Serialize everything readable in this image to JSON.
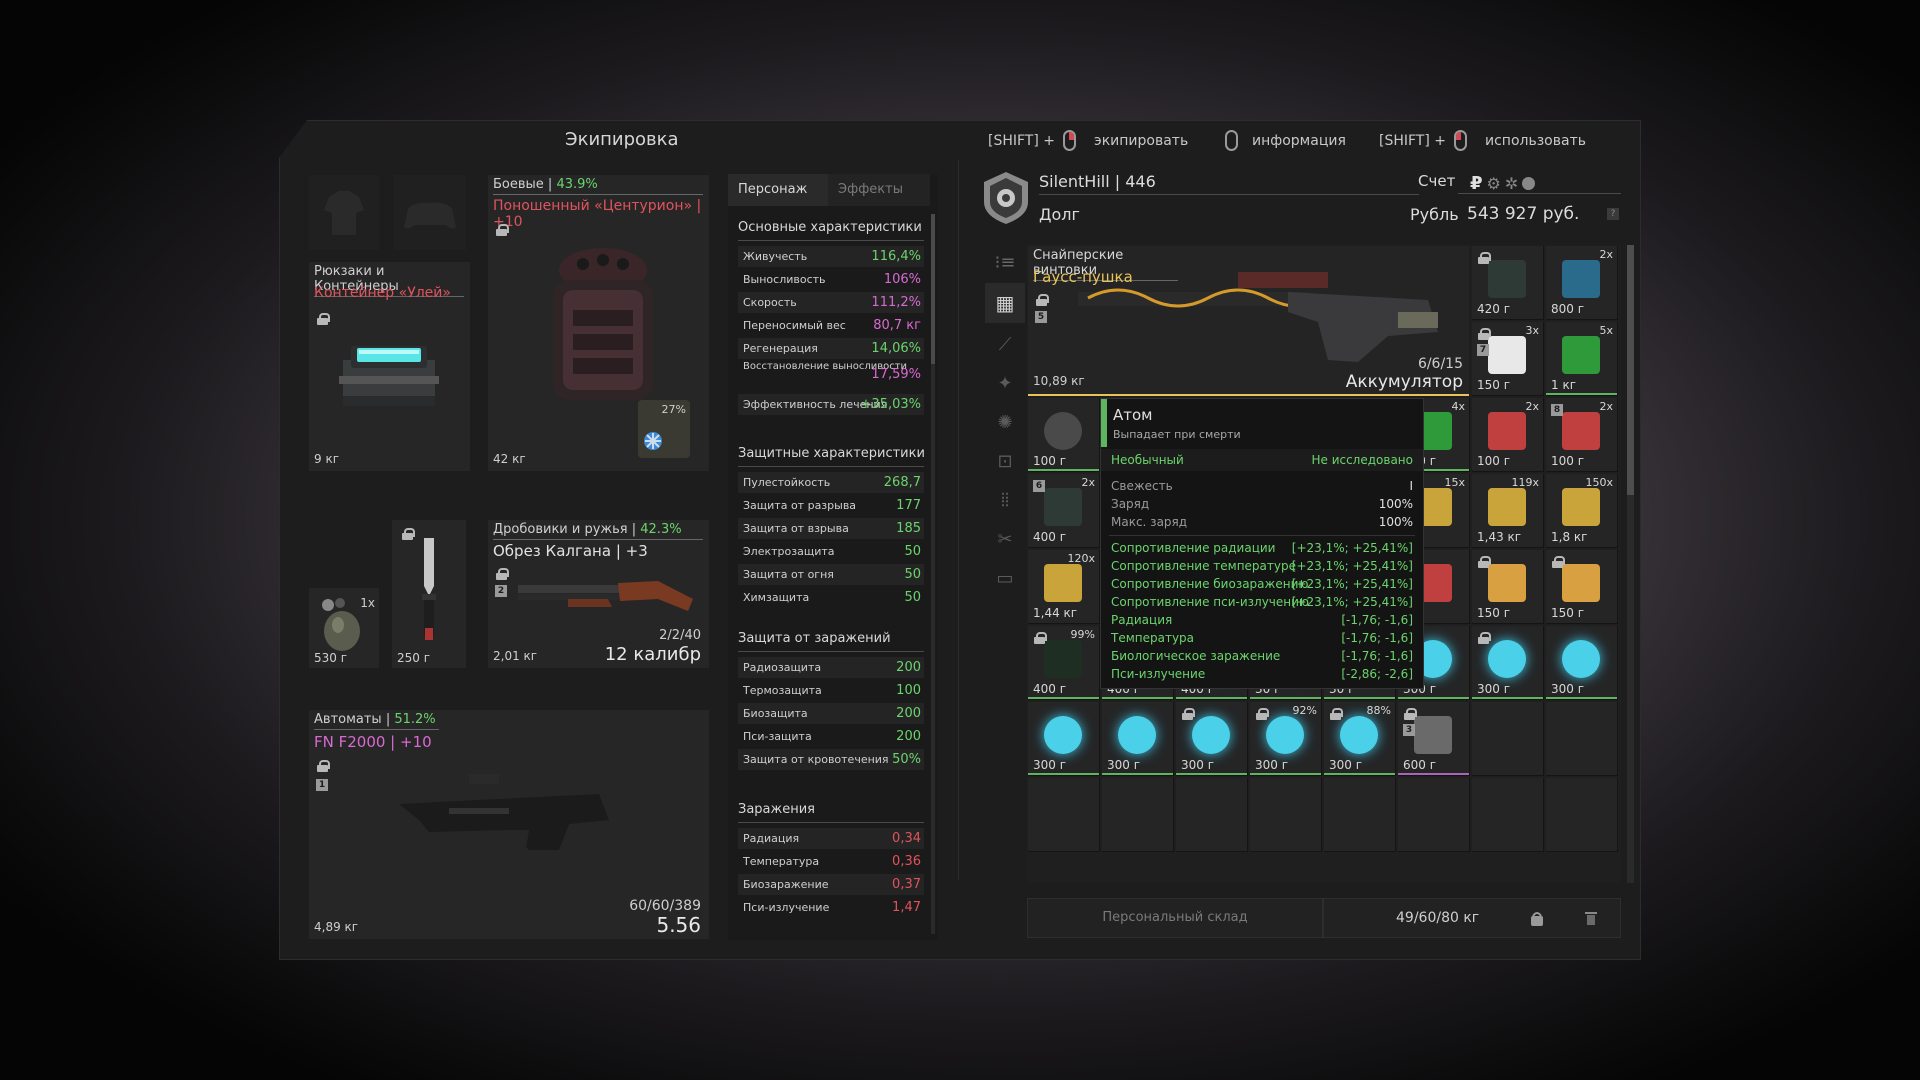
{
  "window_title": "Экипировка",
  "hints": {
    "shift1": "[SHIFT] +",
    "equip": "экипировать",
    "info": "информация",
    "shift2": "[SHIFT] +",
    "use": "использовать"
  },
  "equipment": {
    "backpack": {
      "category": "Рюкзаки и Контейнеры",
      "name": "Контейнер «Улей»",
      "weight": "9 кг"
    },
    "armor": {
      "category": "Боевые",
      "percent": "43.9%",
      "name": "Поношенный «Центурион» | +10",
      "weight": "42 кг",
      "durability": "27%"
    },
    "grenade": {
      "qty": "1x",
      "weight": "530 г"
    },
    "knife": {
      "weight": "250 г"
    },
    "shotgun": {
      "category": "Дробовики и ружья",
      "percent": "42.3%",
      "name": "Обрез Калгана | +3",
      "weight": "2,01 кг",
      "ammo": "2/2/40",
      "caliber": "12 калибр",
      "badge": "2"
    },
    "rifle": {
      "category": "Автоматы",
      "percent": "51.2%",
      "name": "FN F2000 | +10",
      "weight": "4,89 кг",
      "ammo": "60/60/389",
      "caliber": "5.56",
      "badge": "1"
    }
  },
  "stats": {
    "tab_character": "Персонаж",
    "tab_effects": "Эффекты",
    "main_title": "Основные характеристики",
    "main": [
      {
        "k": "Живучесть",
        "v": "116,4%",
        "c": "green"
      },
      {
        "k": "Выносливость",
        "v": "106%",
        "c": "pink"
      },
      {
        "k": "Скорость",
        "v": "111,2%",
        "c": "pink"
      },
      {
        "k": "Переносимый вес",
        "v": "80,7 кг",
        "c": "pink"
      },
      {
        "k": "Регенерация",
        "v": "14,06%",
        "c": "green"
      },
      {
        "k": "Восстановление выносливости",
        "v": "17,59%",
        "c": "pink"
      },
      {
        "k": "Эффективность лечения",
        "v": "+35,03%",
        "c": "green"
      }
    ],
    "def_title": "Защитные характеристики",
    "def": [
      {
        "k": "Пулестойкость",
        "v": "268,7"
      },
      {
        "k": "Защита от разрыва",
        "v": "177"
      },
      {
        "k": "Защита от взрыва",
        "v": "185"
      },
      {
        "k": "Электрозащита",
        "v": "50"
      },
      {
        "k": "Защита от огня",
        "v": "50"
      },
      {
        "k": "Химзащита",
        "v": "50"
      }
    ],
    "inf_title": "Защита от заражений",
    "inf": [
      {
        "k": "Радиозащита",
        "v": "200"
      },
      {
        "k": "Термозащита",
        "v": "100"
      },
      {
        "k": "Биозащита",
        "v": "200"
      },
      {
        "k": "Пси-защита",
        "v": "200"
      },
      {
        "k": "Защита от кровотечения",
        "v": "50%"
      }
    ],
    "cont_title": "Заражения",
    "cont": [
      {
        "k": "Радиация",
        "v": "0,34"
      },
      {
        "k": "Температура",
        "v": "0,36"
      },
      {
        "k": "Биозаражение",
        "v": "0,37"
      },
      {
        "k": "Пси-излучение",
        "v": "1,47"
      }
    ]
  },
  "player": {
    "name": "SilentHill | 446",
    "faction": "Долг",
    "account_label": "Счет",
    "currency_label": "Рубль",
    "money": "543 927 руб."
  },
  "featured": {
    "category": "Снайперские винтовки",
    "name": "Гаусс-пушка",
    "weight": "10,89 кг",
    "ammo": "6/6/15",
    "ammo_type": "Аккумулятор",
    "badge": "5"
  },
  "tooltip": {
    "title": "Атом",
    "subtitle": "Выпадает при смерти",
    "rarity": "Необычный",
    "status": "Не исследовано",
    "props": [
      {
        "k": "Свежесть",
        "v": "I"
      },
      {
        "k": "Заряд",
        "v": "100%"
      },
      {
        "k": "Макс. заряд",
        "v": "100%"
      }
    ],
    "bonuses": [
      {
        "k": "Сопротивление радиации",
        "v": "[+23,1%; +25,41%]"
      },
      {
        "k": "Сопротивление температуре",
        "v": "[+23,1%; +25,41%]"
      },
      {
        "k": "Сопротивление биозаражению",
        "v": "[+23,1%; +25,41%]"
      },
      {
        "k": "Сопротивление пси-излучению",
        "v": "[+23,1%; +25,41%]"
      }
    ],
    "penalties": [
      {
        "k": "Радиация",
        "v": "[-1,76; -1,6]"
      },
      {
        "k": "Температура",
        "v": "[-1,76; -1,6]"
      },
      {
        "k": "Биологическое заражение",
        "v": "[-1,76; -1,6]"
      },
      {
        "k": "Пси-излучение",
        "v": "[-2,86; -2,6]"
      }
    ]
  },
  "inventory": {
    "r1": [
      {
        "w": "420 г",
        "q": ""
      },
      {
        "w": "800 г",
        "q": "2x"
      }
    ],
    "r2": [
      {
        "w": "150 г",
        "q": "3x"
      },
      {
        "w": "1 кг",
        "q": "5x"
      }
    ],
    "r3": [
      {
        "w": "100 г",
        "q": "4x"
      },
      {
        "w": "100 г",
        "q": "2x"
      },
      {
        "w": "100 г",
        "q": "2x"
      }
    ],
    "r4": [
      {
        "w": "400 г",
        "q": "2x"
      },
      {
        "w": "",
        "q": "15x"
      },
      {
        "w": "1,43 кг",
        "q": "119x"
      },
      {
        "w": "1,8 кг",
        "q": "150x"
      }
    ],
    "r5": [
      {
        "w": "1,44 кг",
        "q": "120x"
      },
      {
        "w": "",
        "q": ""
      },
      {
        "w": "150 г",
        "q": ""
      },
      {
        "w": "150 г",
        "q": ""
      }
    ],
    "r6": [
      {
        "w": "400 г",
        "q": "99%"
      },
      {
        "w": "400 г",
        "q": ""
      },
      {
        "w": "400 г",
        "q": ""
      },
      {
        "w": "30 г",
        "q": ""
      },
      {
        "w": "30 г",
        "q": ""
      },
      {
        "w": "300 г",
        "q": ""
      },
      {
        "w": "300 г",
        "q": ""
      },
      {
        "w": "300 г",
        "q": ""
      }
    ],
    "r7": [
      {
        "w": "300 г",
        "q": ""
      },
      {
        "w": "300 г",
        "q": ""
      },
      {
        "w": "300 г",
        "q": ""
      },
      {
        "w": "300 г",
        "q": "92%"
      },
      {
        "w": "300 г",
        "q": "88%"
      },
      {
        "w": "600 г",
        "q": ""
      }
    ],
    "atom_weight": "100 г",
    "atom_badge": "6",
    "cell_badge_7": "7",
    "cell_badge_8": "8",
    "cell_badge_3": "3"
  },
  "footer": {
    "storage": "Персональный склад",
    "weight": "49/60/80 кг"
  },
  "colors": {
    "green": "#6cd46c",
    "red": "#e0535c",
    "pink": "#d86ad0",
    "gold": "#e8c35a"
  }
}
